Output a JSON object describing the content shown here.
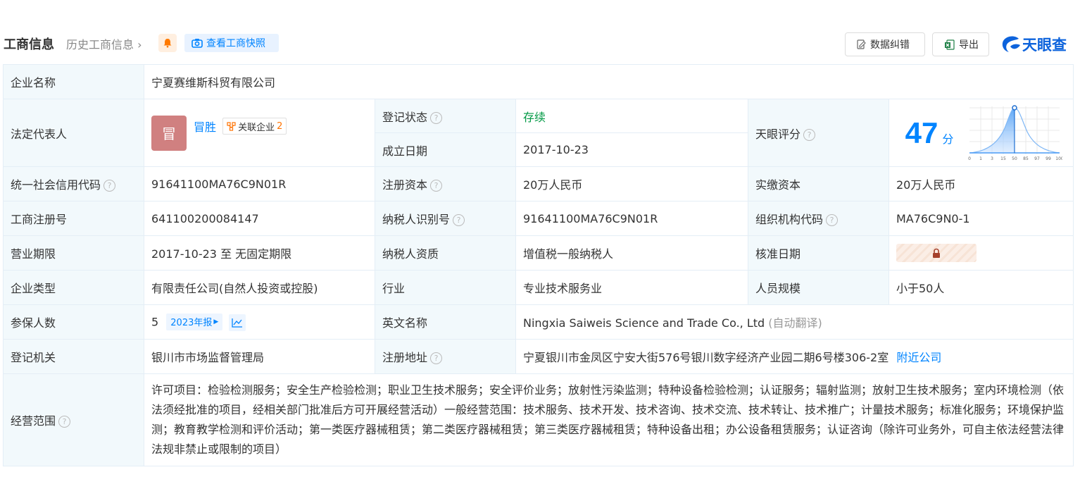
{
  "header": {
    "title": "工商信息",
    "history_link": "历史工商信息",
    "snapshot_btn": "查看工商快照",
    "error_btn": "数据纠错",
    "export_btn": "导出",
    "logo_text": "天眼查"
  },
  "rows": {
    "company_name": {
      "label": "企业名称",
      "value": "宁夏赛维斯科贸有限公司"
    },
    "legal_rep": {
      "label": "法定代表人",
      "avatar": "冒",
      "name": "冒胜",
      "related_label": "关联企业",
      "related_count": "2"
    },
    "reg_status": {
      "label": "登记状态",
      "value": "存续"
    },
    "found_date": {
      "label": "成立日期",
      "value": "2017-10-23"
    },
    "tianyan_score": {
      "label": "天眼评分",
      "score": "47",
      "unit": "分",
      "axis_ticks": [
        "0",
        "1",
        "3",
        "15",
        "50",
        "85",
        "97",
        "99",
        "100"
      ]
    },
    "credit_code": {
      "label": "统一社会信用代码",
      "value": "91641100MA76C9N01R"
    },
    "reg_capital": {
      "label": "注册资本",
      "value": "20万人民币"
    },
    "paid_capital": {
      "label": "实缴资本",
      "value": "20万人民币"
    },
    "reg_number": {
      "label": "工商注册号",
      "value": "641100200084147"
    },
    "taxpayer_id": {
      "label": "纳税人识别号",
      "value": "91641100MA76C9N01R"
    },
    "org_code": {
      "label": "组织机构代码",
      "value": "MA76C9N0-1"
    },
    "term": {
      "label": "营业期限",
      "value": "2017-10-23 至 无固定期限"
    },
    "taxpayer_qual": {
      "label": "纳税人资质",
      "value": "增值税一般纳税人"
    },
    "approve_date": {
      "label": "核准日期"
    },
    "company_type": {
      "label": "企业类型",
      "value": "有限责任公司(自然人投资或控股)"
    },
    "industry": {
      "label": "行业",
      "value": "专业技术服务业"
    },
    "staff_size": {
      "label": "人员规模",
      "value": "小于50人"
    },
    "insured": {
      "label": "参保人数",
      "value": "5",
      "year_btn": "2023年报"
    },
    "english_name": {
      "label": "英文名称",
      "value": "Ningxia Saiweis Science and Trade Co., Ltd",
      "note": "(自动翻译)"
    },
    "reg_authority": {
      "label": "登记机关",
      "value": "银川市市场监督管理局"
    },
    "reg_address": {
      "label": "注册地址",
      "value": "宁夏银川市金凤区宁安大街576号银川数字经济产业园二期6号楼306-2室",
      "nearby_link": "附近公司"
    },
    "scope": {
      "label": "经营范围",
      "value": "许可项目：检验检测服务；安全生产检验检测；职业卫生技术服务；安全评价业务；放射性污染监测；特种设备检验检测；认证服务；辐射监测；放射卫生技术服务；室内环境检测（依法须经批准的项目，经相关部门批准后方可开展经营活动）一般经营范围：技术服务、技术开发、技术咨询、技术交流、技术转让、技术推广；计量技术服务；标准化服务；环境保护监测；教育教学检测和评价活动；第一类医疗器械租赁；第二类医疗器械租赁；第三类医疗器械租赁；特种设备出租；办公设备租赁服务；认证咨询（除许可业务外，可自主依法经营法律法规非禁止或限制的项目）"
    }
  },
  "colors": {
    "accent": "#0084ff",
    "status": "#009944",
    "label_bg": "#f2f9fc"
  }
}
